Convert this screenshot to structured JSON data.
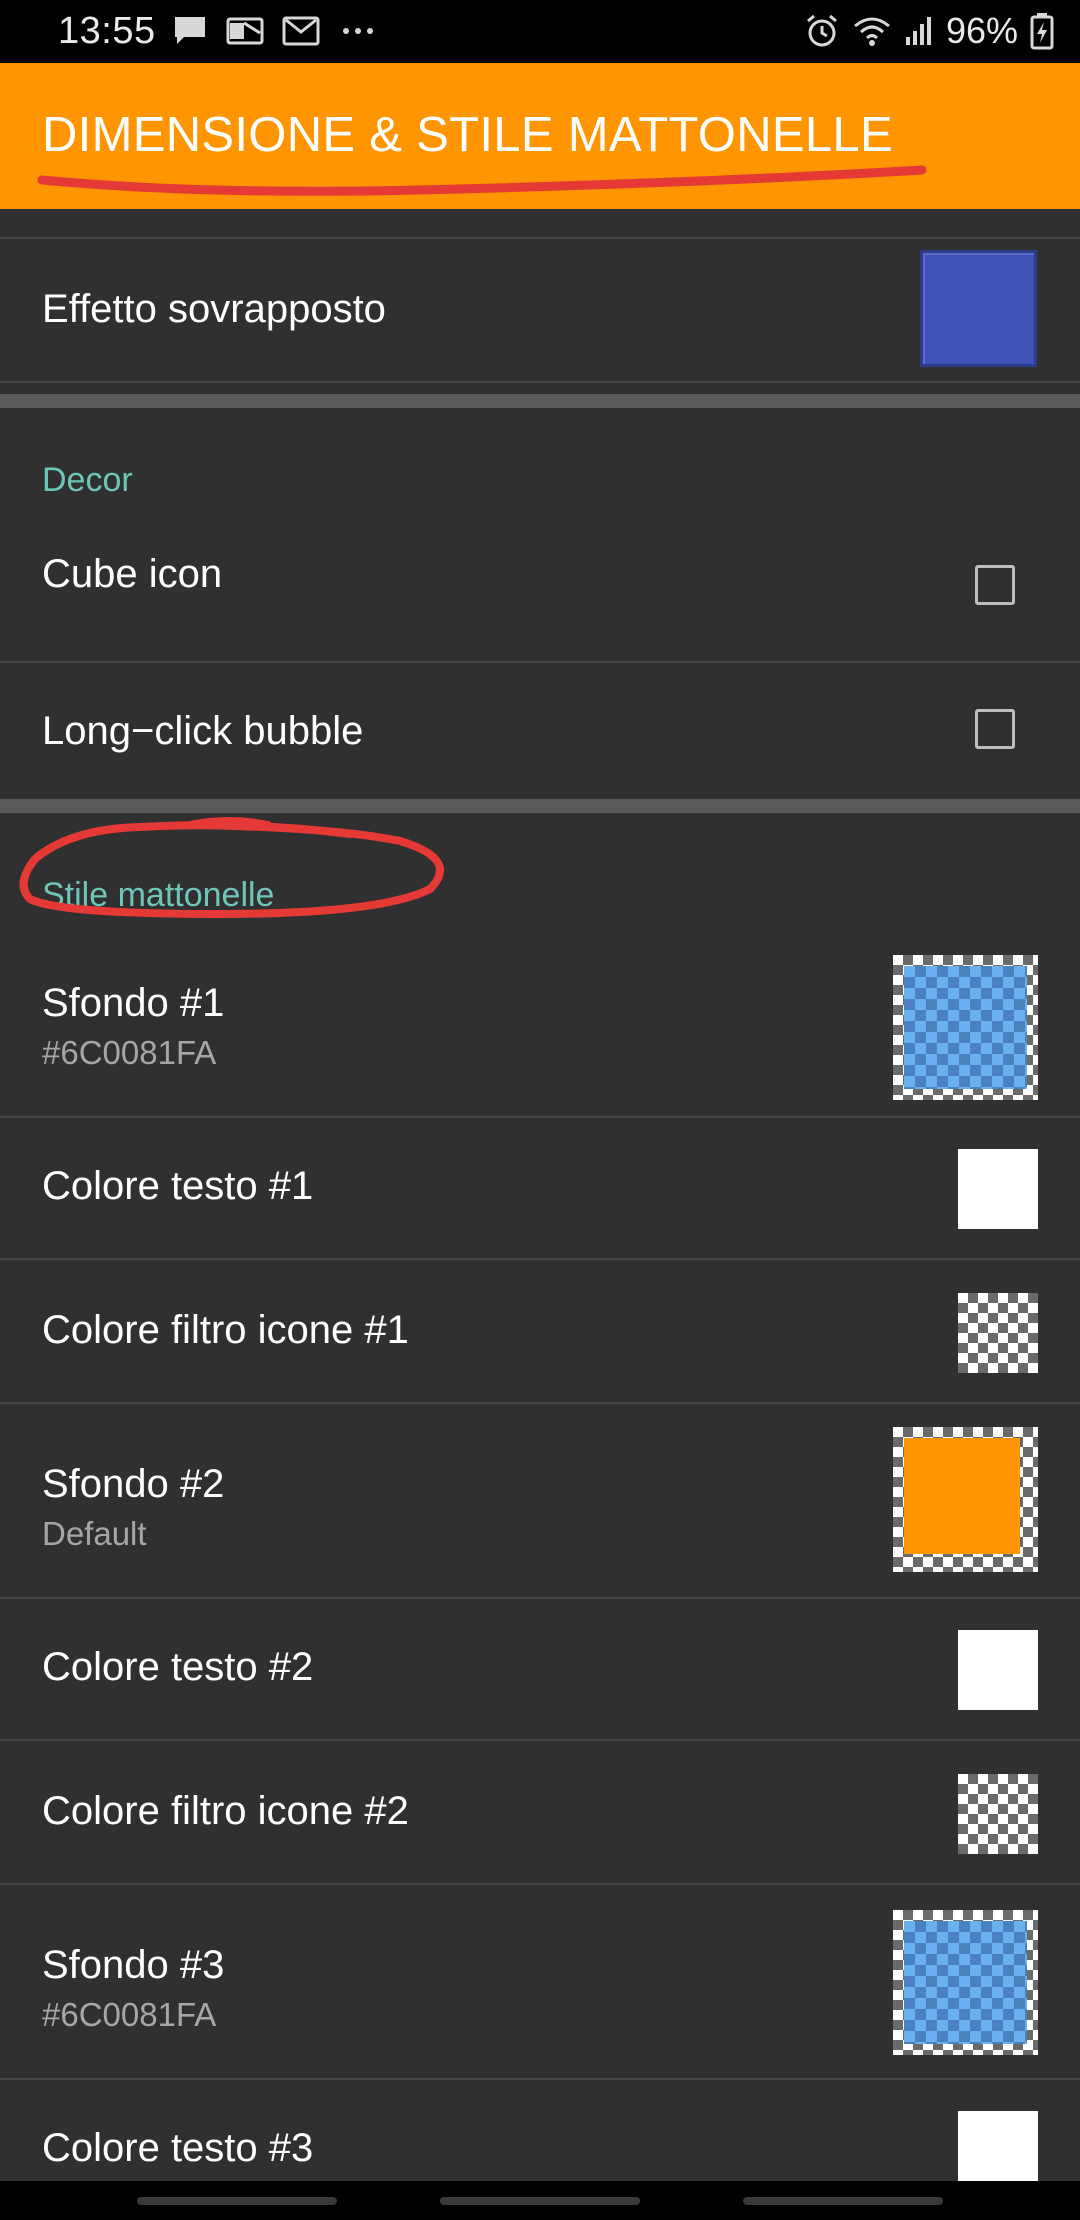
{
  "status_bar": {
    "time": "13:55",
    "battery": "96%",
    "left_icons": [
      "chat-icon",
      "outlook-icon",
      "gmail-icon",
      "more-dots-icon"
    ],
    "right_icons": [
      "alarm-icon",
      "wifi-icon",
      "signal-icon",
      "battery-charging-icon"
    ]
  },
  "toolbar": {
    "title": "DIMENSIONE & STILE MATTONELLE"
  },
  "rows": {
    "overlay_effect": {
      "title": "Effetto sovrapposto",
      "swatch_color": "#3f51b5"
    },
    "decor_header": "Decor",
    "cube_icon": {
      "title": "Cube icon",
      "checked": false
    },
    "long_click": {
      "title": "Long−click bubble",
      "checked": false
    },
    "tile_style_header": "Stile mattonelle",
    "bg1": {
      "title": "Sfondo #1",
      "value": "#6C0081FA"
    },
    "text_color1": {
      "title": "Colore testo #1",
      "swatch_color": "#ffffff"
    },
    "icon_filter1": {
      "title": "Colore filtro icone #1"
    },
    "bg2": {
      "title": "Sfondo #2",
      "value": "Default",
      "swatch_color": "#ff9500"
    },
    "text_color2": {
      "title": "Colore testo #2",
      "swatch_color": "#ffffff"
    },
    "icon_filter2": {
      "title": "Colore filtro icone #2"
    },
    "bg3": {
      "title": "Sfondo #3",
      "value": "#6C0081FA"
    },
    "text_color3": {
      "title": "Colore testo #3",
      "swatch_color": "#ffffff"
    }
  },
  "colors": {
    "accent": "#ff9500",
    "section_header": "#6ec6b8",
    "background": "#303030",
    "annotation": "#e53935"
  }
}
